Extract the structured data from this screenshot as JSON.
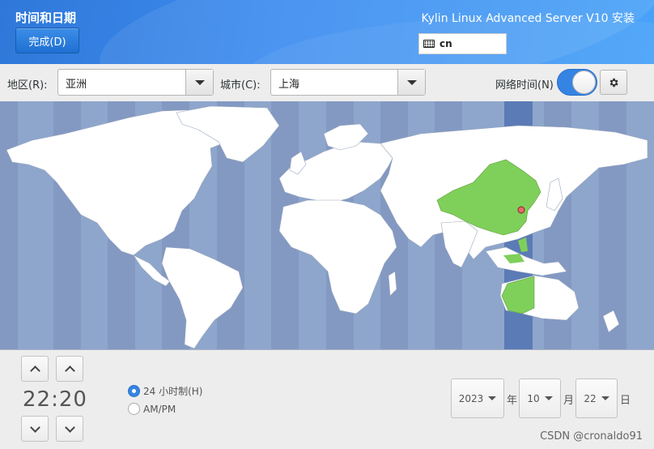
{
  "header": {
    "title": "时间和日期",
    "done_label": "完成(D)",
    "product": "Kylin Linux Advanced Server V10 安装",
    "keyboard_layout": "cn"
  },
  "toolbar": {
    "region_label": "地区(R):",
    "region_value": "亚洲",
    "city_label": "城市(C):",
    "city_value": "上海",
    "network_time_label": "网络时间(N)",
    "network_time_on": true
  },
  "map": {
    "highlight_color": "#7fd05a",
    "ocean_color": "#8ea6cc",
    "selected_city": "上海"
  },
  "time": {
    "value": "22:20",
    "format_24h_label": "24 小时制(H)",
    "format_ampm_label": "AM/PM",
    "selected_format": "24h"
  },
  "date": {
    "year": "2023",
    "year_unit": "年",
    "month": "10",
    "month_unit": "月",
    "day": "22",
    "day_unit": "日"
  },
  "watermark": "CSDN @cronaldo91",
  "colors": {
    "accent": "#3584e4",
    "header_blue": "#3d8df0"
  }
}
